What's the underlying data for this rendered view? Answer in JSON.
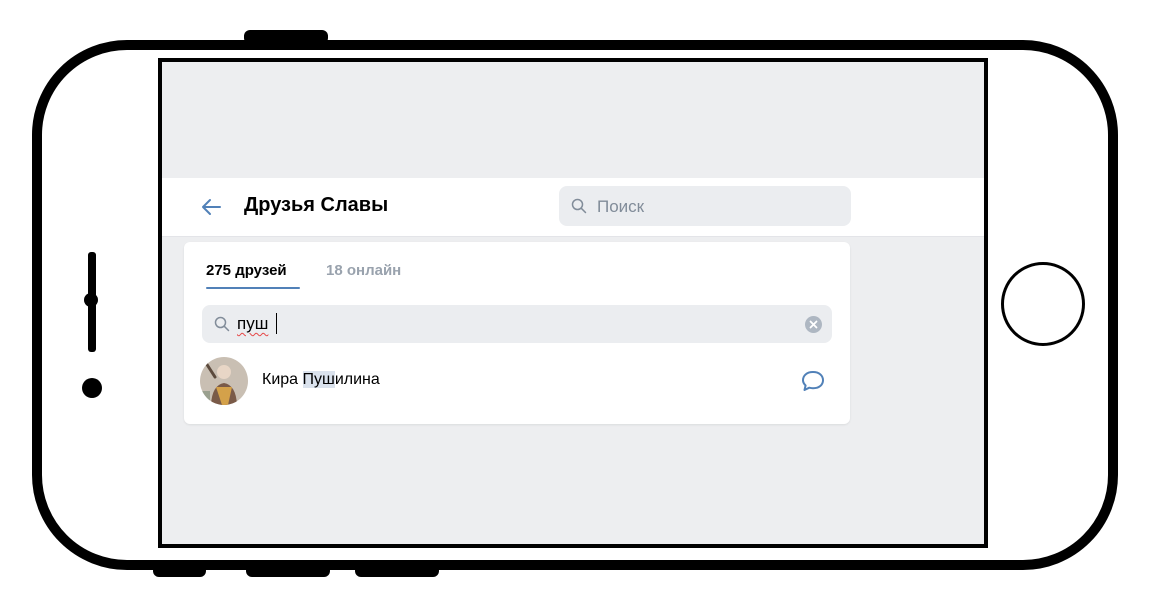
{
  "header": {
    "title": "Друзья Славы",
    "search_placeholder": "Поиск"
  },
  "tabs": [
    {
      "label": "275 друзей",
      "active": true
    },
    {
      "label": "18 онлайн",
      "active": false
    }
  ],
  "filter": {
    "query": "пуш"
  },
  "friends": [
    {
      "name_before": "Кира ",
      "name_match": "Пуш",
      "name_after": "илина"
    }
  ],
  "icons": {
    "back": "arrow-left-icon",
    "search": "search-icon",
    "clear": "clear-icon",
    "message": "message-icon"
  },
  "colors": {
    "accent": "#5181b8",
    "screen_background": "#edeef0",
    "muted_text": "#99a2ad",
    "highlight": "#dae2ed"
  }
}
